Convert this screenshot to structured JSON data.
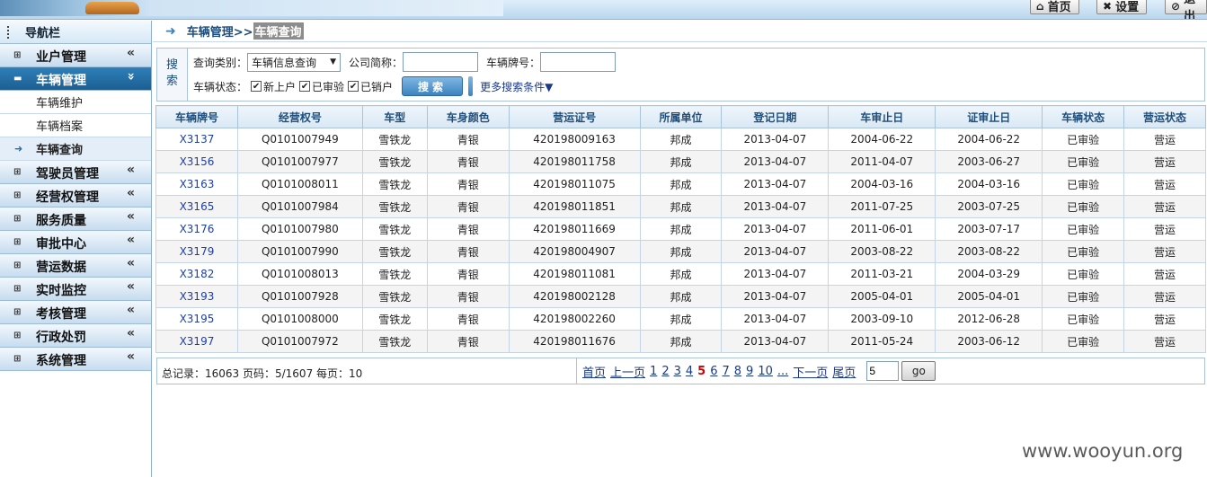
{
  "banner": {
    "buttons": [
      {
        "icon": "home-icon",
        "glyph": "⌂",
        "label": "首页"
      },
      {
        "icon": "tools-icon",
        "glyph": "✖",
        "label": "设置"
      },
      {
        "icon": "exit-icon",
        "glyph": "⊘",
        "label": "退出"
      }
    ]
  },
  "sidebar": {
    "title": "导航栏",
    "menus": [
      {
        "label": "业户管理",
        "expanded": false
      },
      {
        "label": "车辆管理",
        "expanded": true,
        "items": [
          {
            "label": "车辆维护"
          },
          {
            "label": "车辆档案"
          },
          {
            "label": "车辆查询",
            "current": true
          }
        ]
      },
      {
        "label": "驾驶员管理",
        "expanded": false
      },
      {
        "label": "经营权管理",
        "expanded": false
      },
      {
        "label": "服务质量",
        "expanded": false
      },
      {
        "label": "审批中心",
        "expanded": false
      },
      {
        "label": "营运数据",
        "expanded": false
      },
      {
        "label": "实时监控",
        "expanded": false
      },
      {
        "label": "考核管理",
        "expanded": false
      },
      {
        "label": "行政处罚",
        "expanded": false
      },
      {
        "label": "系统管理",
        "expanded": false
      }
    ]
  },
  "breadcrumb": {
    "parent": "车辆管理>>",
    "current": "车辆查询"
  },
  "search": {
    "side_label_1": "搜",
    "side_label_2": "索",
    "query_type_label": "查询类别：",
    "query_type_value": "车辆信息查询",
    "company_label": "公司简称：",
    "company_value": "",
    "plate_label": "车辆牌号：",
    "plate_value": "",
    "status_label": "车辆状态：",
    "status_options": [
      {
        "label": "新上户",
        "checked": true
      },
      {
        "label": "已审验",
        "checked": true
      },
      {
        "label": "已销户",
        "checked": true
      }
    ],
    "search_button": "搜索",
    "more_link": "更多搜索条件▼"
  },
  "table": {
    "columns": [
      "车辆牌号",
      "经营权号",
      "车型",
      "车身颜色",
      "营运证号",
      "所属单位",
      "登记日期",
      "车审止日",
      "证审止日",
      "车辆状态",
      "营运状态"
    ],
    "rows": [
      [
        "X3137",
        "Q0101007949",
        "雪铁龙",
        "青银",
        "420198009163",
        "邦成",
        "2013-04-07",
        "2004-06-22",
        "2004-06-22",
        "已审验",
        "营运"
      ],
      [
        "X3156",
        "Q0101007977",
        "雪铁龙",
        "青银",
        "420198011758",
        "邦成",
        "2013-04-07",
        "2011-04-07",
        "2003-06-27",
        "已审验",
        "营运"
      ],
      [
        "X3163",
        "Q0101008011",
        "雪铁龙",
        "青银",
        "420198011075",
        "邦成",
        "2013-04-07",
        "2004-03-16",
        "2004-03-16",
        "已审验",
        "营运"
      ],
      [
        "X3165",
        "Q0101007984",
        "雪铁龙",
        "青银",
        "420198011851",
        "邦成",
        "2013-04-07",
        "2011-07-25",
        "2003-07-25",
        "已审验",
        "营运"
      ],
      [
        "X3176",
        "Q0101007980",
        "雪铁龙",
        "青银",
        "420198011669",
        "邦成",
        "2013-04-07",
        "2011-06-01",
        "2003-07-17",
        "已审验",
        "营运"
      ],
      [
        "X3179",
        "Q0101007990",
        "雪铁龙",
        "青银",
        "420198004907",
        "邦成",
        "2013-04-07",
        "2003-08-22",
        "2003-08-22",
        "已审验",
        "营运"
      ],
      [
        "X3182",
        "Q0101008013",
        "雪铁龙",
        "青银",
        "420198011081",
        "邦成",
        "2013-04-07",
        "2011-03-21",
        "2004-03-29",
        "已审验",
        "营运"
      ],
      [
        "X3193",
        "Q0101007928",
        "雪铁龙",
        "青银",
        "420198002128",
        "邦成",
        "2013-04-07",
        "2005-04-01",
        "2005-04-01",
        "已审验",
        "营运"
      ],
      [
        "X3195",
        "Q0101008000",
        "雪铁龙",
        "青银",
        "420198002260",
        "邦成",
        "2013-04-07",
        "2003-09-10",
        "2012-06-28",
        "已审验",
        "营运"
      ],
      [
        "X3197",
        "Q0101007972",
        "雪铁龙",
        "青银",
        "420198011676",
        "邦成",
        "2013-04-07",
        "2011-05-24",
        "2003-06-12",
        "已审验",
        "营运"
      ]
    ],
    "column_widths": [
      91,
      139,
      72,
      91,
      146,
      91,
      119,
      119,
      119,
      91,
      91
    ]
  },
  "pager": {
    "summary": "总记录：16063 页码：5/1607 每页：10",
    "first": "首页",
    "prev": "上一页",
    "pages": [
      "1",
      "2",
      "3",
      "4",
      "5",
      "6",
      "7",
      "8",
      "9",
      "10",
      "..."
    ],
    "current_page": "5",
    "next": "下一页",
    "last": "尾页",
    "goto_value": "5",
    "go_label": "go"
  },
  "watermark": "www.wooyun.org"
}
